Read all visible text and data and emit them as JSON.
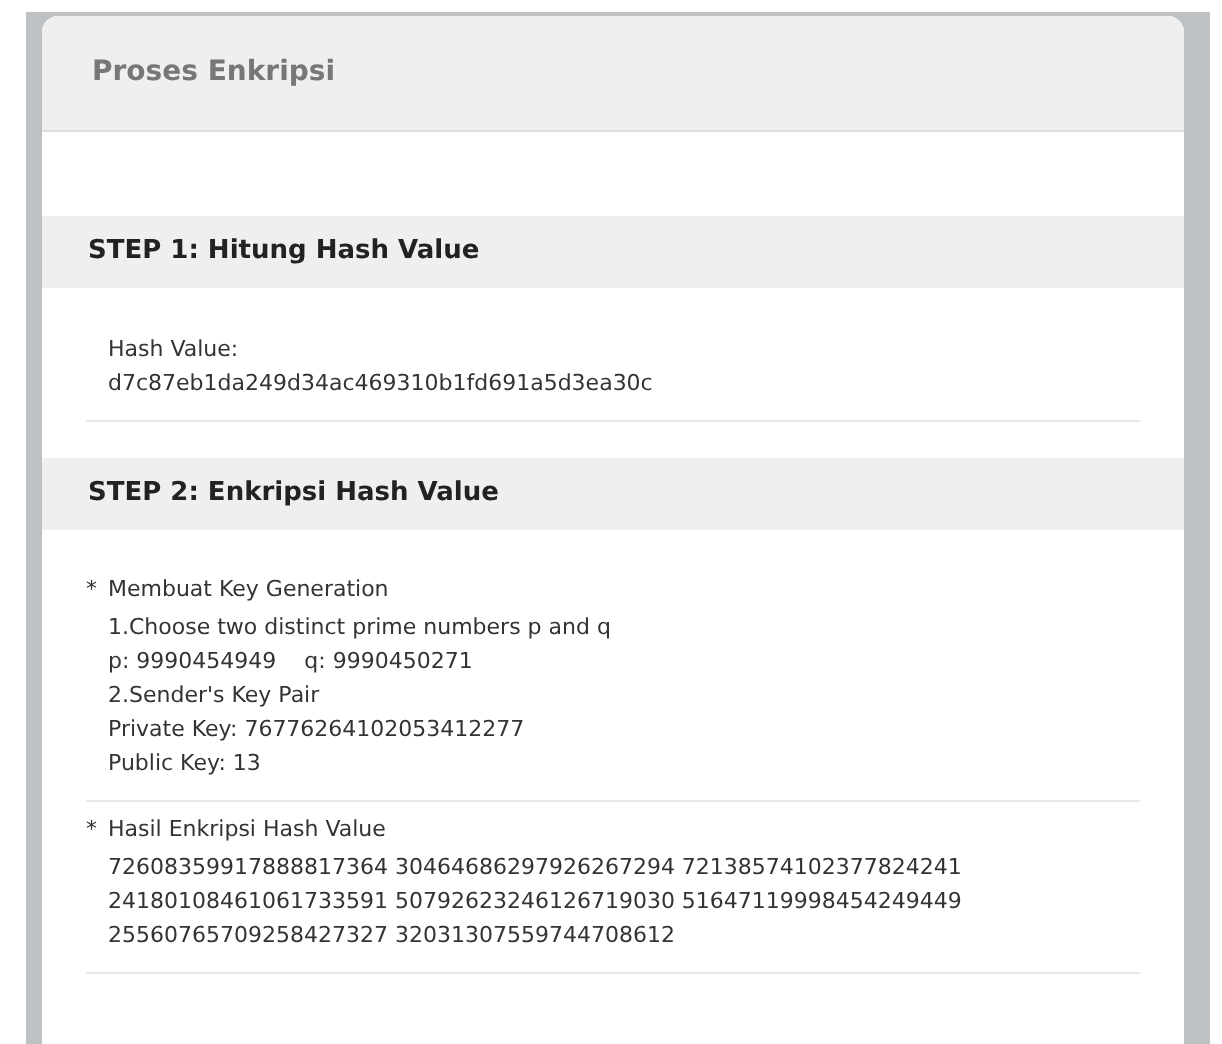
{
  "panel": {
    "title": "Proses Enkripsi"
  },
  "steps": [
    {
      "title": "STEP 1: Hitung Hash Value",
      "blocks": [
        {
          "lines": [
            "Hash Value:",
            "d7c87eb1da249d34ac469310b1fd691a5d3ea30c"
          ]
        }
      ]
    },
    {
      "title": "STEP 2: Enkripsi Hash Value",
      "blocks": [
        {
          "bullet": "*",
          "heading": "Membuat Key Generation",
          "lines": [
            "1.Choose two distinct prime numbers p and q",
            "p: 9990454949    q: 9990450271",
            "2.Sender's Key Pair",
            "Private Key: 76776264102053412277",
            "Public Key: 13"
          ]
        },
        {
          "bullet": "*",
          "heading": "Hasil Enkripsi Hash Value",
          "lines": [
            "72608359917888817364 30464686297926267294 72138574102377824241",
            "24180108461061733591 50792623246126719030 51647119998454249449",
            "25560765709258427327 32031307559744708612"
          ]
        }
      ]
    }
  ]
}
